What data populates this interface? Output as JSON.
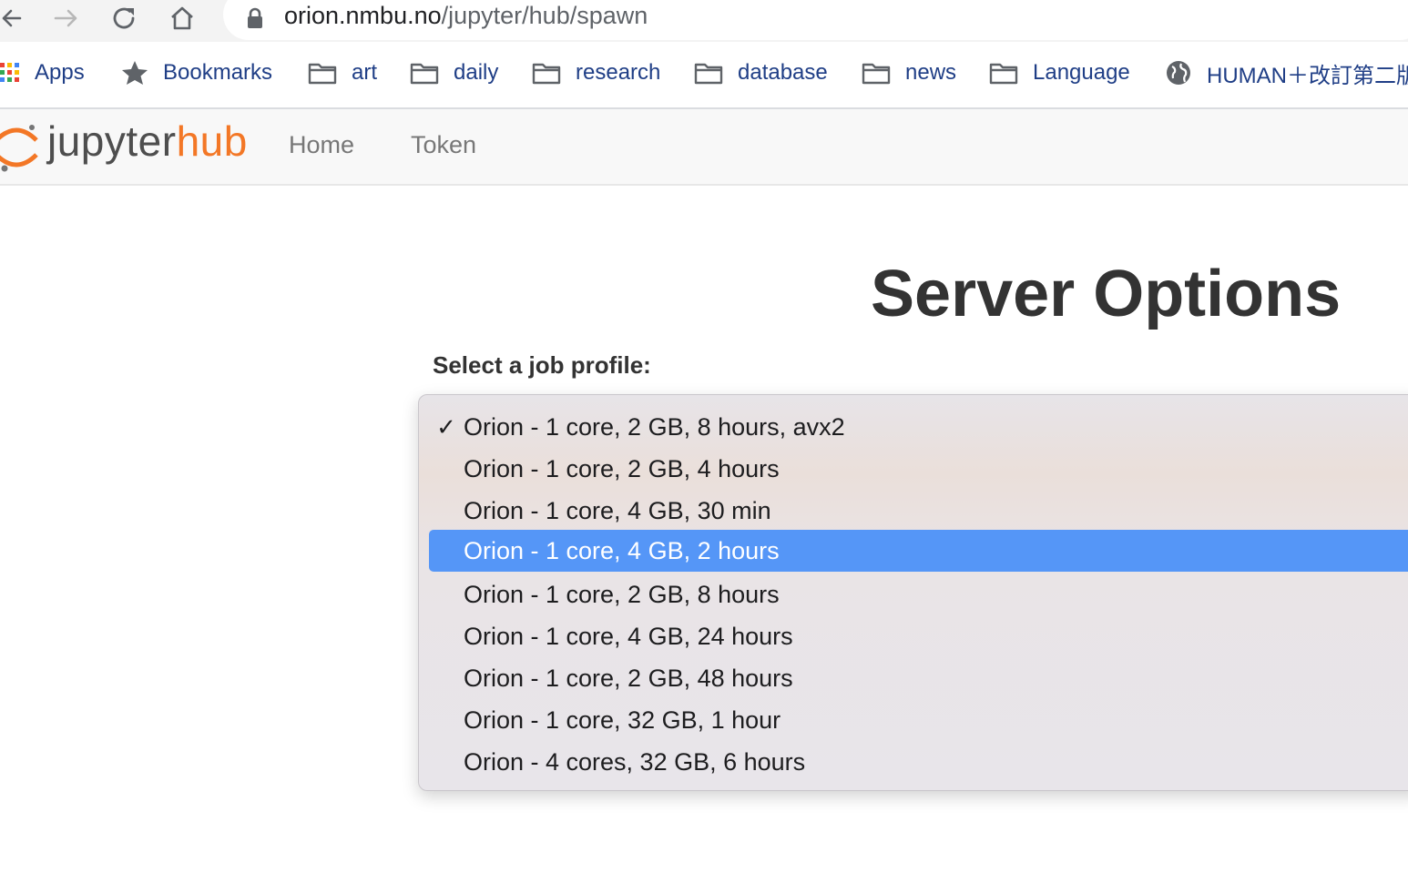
{
  "browser": {
    "url_host": "orion.nmbu.no",
    "url_path": "/jupyter/hub/spawn"
  },
  "bookmarks": [
    {
      "label": "Apps",
      "icon": "apps-grid-icon"
    },
    {
      "label": "Bookmarks",
      "icon": "star-icon"
    },
    {
      "label": "art",
      "icon": "folder-icon"
    },
    {
      "label": "daily",
      "icon": "folder-icon"
    },
    {
      "label": "research",
      "icon": "folder-icon"
    },
    {
      "label": "database",
      "icon": "folder-icon"
    },
    {
      "label": "news",
      "icon": "folder-icon"
    },
    {
      "label": "Language",
      "icon": "folder-icon"
    },
    {
      "label": "HUMAN＋改訂第二版",
      "icon": "globe-icon"
    }
  ],
  "header": {
    "logo_jupyter": "jupyter",
    "logo_hub": "hub",
    "nav": [
      {
        "label": "Home"
      },
      {
        "label": "Token"
      }
    ]
  },
  "main": {
    "title": "Server Options",
    "select_label": "Select a job profile:",
    "options": [
      {
        "label": "Orion - 1 core, 2 GB, 8 hours, avx2",
        "checked": "✓"
      },
      {
        "label": "Orion - 1 core, 2 GB, 4 hours",
        "checked": ""
      },
      {
        "label": "Orion - 1 core, 4 GB, 30 min",
        "checked": ""
      },
      {
        "label": "Orion - 1 core, 4 GB, 2 hours",
        "checked": ""
      },
      {
        "label": "Orion - 1 core, 2 GB, 8 hours",
        "checked": ""
      },
      {
        "label": "Orion - 1 core, 4 GB, 24 hours",
        "checked": ""
      },
      {
        "label": "Orion - 1 core, 2 GB, 48 hours",
        "checked": ""
      },
      {
        "label": "Orion - 1 core, 32 GB, 1 hour",
        "checked": ""
      },
      {
        "label": "Orion - 4 cores, 32 GB, 6 hours",
        "checked": ""
      }
    ],
    "highlighted_option": "Orion - 1 core, 4 GB, 2 hours"
  },
  "colors": {
    "accent_orange": "#f37726",
    "highlight_blue": "#5596f7",
    "bookmark_text": "#1f3e86"
  }
}
